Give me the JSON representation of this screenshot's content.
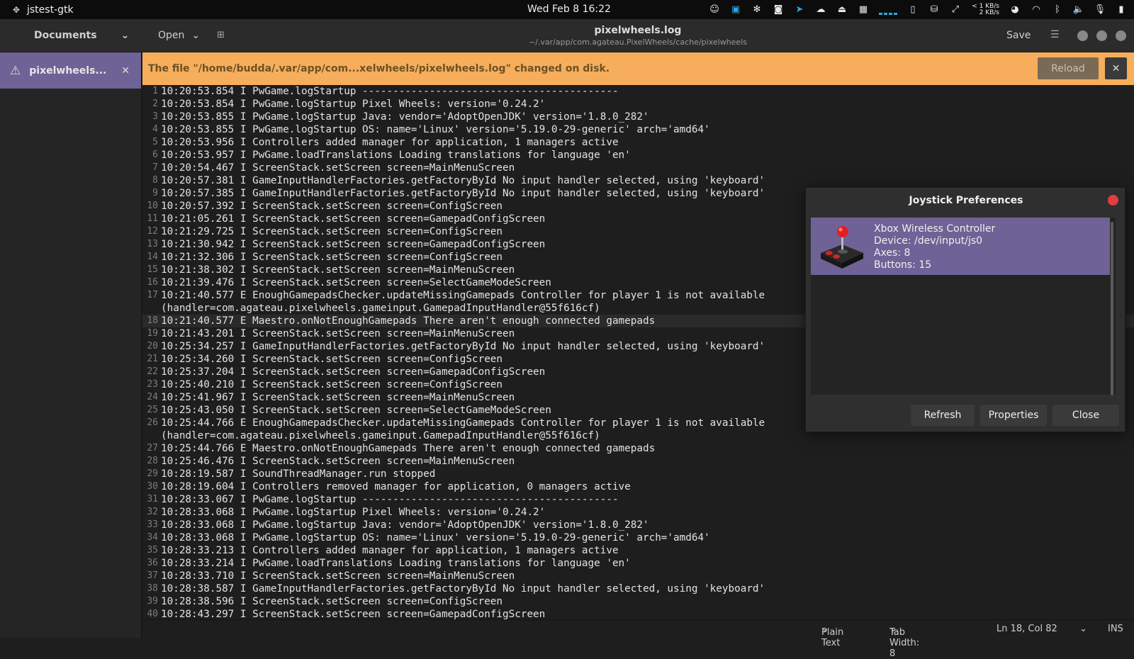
{
  "topbar": {
    "app_name": "jstest-gtk",
    "clock": "Wed Feb 8  16:22",
    "net_up": "< 1 KB/s",
    "net_down": "2 KB/s"
  },
  "header": {
    "documents_label": "Documents",
    "open_label": "Open",
    "title": "pixelwheels.log",
    "subtitle": "~/.var/app/com.agateau.PixelWheels/cache/pixelwheels",
    "save_label": "Save"
  },
  "sidebar": {
    "doc_name": "pixelwheels...."
  },
  "infobar": {
    "message": "The file \"/home/budda/.var/app/com...xelwheels/pixelwheels.log\" changed on disk.",
    "reload_label": "Reload"
  },
  "editor": {
    "lines": [
      {
        "n": "1",
        "t": "10:20:53.854 I PwGame.logStartup ------------------------------------------"
      },
      {
        "n": "2",
        "t": "10:20:53.854 I PwGame.logStartup Pixel Wheels: version='0.24.2'"
      },
      {
        "n": "3",
        "t": "10:20:53.855 I PwGame.logStartup Java: vendor='AdoptOpenJDK' version='1.8.0_282'"
      },
      {
        "n": "4",
        "t": "10:20:53.855 I PwGame.logStartup OS: name='Linux' version='5.19.0-29-generic' arch='amd64'"
      },
      {
        "n": "5",
        "t": "10:20:53.956 I Controllers added manager for application, 1 managers active"
      },
      {
        "n": "6",
        "t": "10:20:53.957 I PwGame.loadTranslations Loading translations for language 'en'"
      },
      {
        "n": "7",
        "t": "10:20:54.467 I ScreenStack.setScreen screen=MainMenuScreen"
      },
      {
        "n": "8",
        "t": "10:20:57.381 I GameInputHandlerFactories.getFactoryById No input handler selected, using 'keyboard'"
      },
      {
        "n": "9",
        "t": "10:20:57.385 I GameInputHandlerFactories.getFactoryById No input handler selected, using 'keyboard'"
      },
      {
        "n": "10",
        "t": "10:20:57.392 I ScreenStack.setScreen screen=ConfigScreen"
      },
      {
        "n": "11",
        "t": "10:21:05.261 I ScreenStack.setScreen screen=GamepadConfigScreen"
      },
      {
        "n": "12",
        "t": "10:21:29.725 I ScreenStack.setScreen screen=ConfigScreen"
      },
      {
        "n": "13",
        "t": "10:21:30.942 I ScreenStack.setScreen screen=GamepadConfigScreen"
      },
      {
        "n": "14",
        "t": "10:21:32.306 I ScreenStack.setScreen screen=ConfigScreen"
      },
      {
        "n": "15",
        "t": "10:21:38.302 I ScreenStack.setScreen screen=MainMenuScreen"
      },
      {
        "n": "16",
        "t": "10:21:39.476 I ScreenStack.setScreen screen=SelectGameModeScreen"
      },
      {
        "n": "17",
        "t": "10:21:40.577 E EnoughGamepadsChecker.updateMissingGamepads Controller for player 1 is not available"
      },
      {
        "n": "",
        "t": "(handler=com.agateau.pixelwheels.gameinput.GamepadInputHandler@55f616cf)"
      },
      {
        "n": "18",
        "t": "10:21:40.577 E Maestro.onNotEnoughGamepads There aren't enough connected gamepads"
      },
      {
        "n": "19",
        "t": "10:21:43.201 I ScreenStack.setScreen screen=MainMenuScreen"
      },
      {
        "n": "20",
        "t": "10:25:34.257 I GameInputHandlerFactories.getFactoryById No input handler selected, using 'keyboard'"
      },
      {
        "n": "21",
        "t": "10:25:34.260 I ScreenStack.setScreen screen=ConfigScreen"
      },
      {
        "n": "22",
        "t": "10:25:37.204 I ScreenStack.setScreen screen=GamepadConfigScreen"
      },
      {
        "n": "23",
        "t": "10:25:40.210 I ScreenStack.setScreen screen=ConfigScreen"
      },
      {
        "n": "24",
        "t": "10:25:41.967 I ScreenStack.setScreen screen=MainMenuScreen"
      },
      {
        "n": "25",
        "t": "10:25:43.050 I ScreenStack.setScreen screen=SelectGameModeScreen"
      },
      {
        "n": "26",
        "t": "10:25:44.766 E EnoughGamepadsChecker.updateMissingGamepads Controller for player 1 is not available"
      },
      {
        "n": "",
        "t": "(handler=com.agateau.pixelwheels.gameinput.GamepadInputHandler@55f616cf)"
      },
      {
        "n": "27",
        "t": "10:25:44.766 E Maestro.onNotEnoughGamepads There aren't enough connected gamepads"
      },
      {
        "n": "28",
        "t": "10:25:46.476 I ScreenStack.setScreen screen=MainMenuScreen"
      },
      {
        "n": "29",
        "t": "10:28:19.587 I SoundThreadManager.run stopped"
      },
      {
        "n": "30",
        "t": "10:28:19.604 I Controllers removed manager for application, 0 managers active"
      },
      {
        "n": "31",
        "t": "10:28:33.067 I PwGame.logStartup ------------------------------------------"
      },
      {
        "n": "32",
        "t": "10:28:33.068 I PwGame.logStartup Pixel Wheels: version='0.24.2'"
      },
      {
        "n": "33",
        "t": "10:28:33.068 I PwGame.logStartup Java: vendor='AdoptOpenJDK' version='1.8.0_282'"
      },
      {
        "n": "34",
        "t": "10:28:33.068 I PwGame.logStartup OS: name='Linux' version='5.19.0-29-generic' arch='amd64'"
      },
      {
        "n": "35",
        "t": "10:28:33.213 I Controllers added manager for application, 1 managers active"
      },
      {
        "n": "36",
        "t": "10:28:33.214 I PwGame.loadTranslations Loading translations for language 'en'"
      },
      {
        "n": "37",
        "t": "10:28:33.710 I ScreenStack.setScreen screen=MainMenuScreen"
      },
      {
        "n": "38",
        "t": "10:28:38.587 I GameInputHandlerFactories.getFactoryById No input handler selected, using 'keyboard'"
      },
      {
        "n": "39",
        "t": "10:28:38.596 I ScreenStack.setScreen screen=ConfigScreen"
      },
      {
        "n": "40",
        "t": "10:28:43.297 I ScreenStack.setScreen screen=GamepadConfigScreen"
      }
    ],
    "current_line_index": 18
  },
  "statusbar": {
    "language": "Plain Text",
    "tab_width": "Tab Width: 8",
    "position": "Ln 18, Col 82",
    "mode": "INS"
  },
  "dialog": {
    "title": "Joystick Preferences",
    "device_name": "Xbox Wireless Controller",
    "device_path": "Device: /dev/input/js0",
    "axes": "Axes: 8",
    "buttons": "Buttons: 15",
    "refresh_label": "Refresh",
    "properties_label": "Properties",
    "close_label": "Close"
  },
  "colors": {
    "accent": "#6f6296",
    "infobar": "#f6ae5c",
    "close_dot": "#e43d3d",
    "tray_blue": "#2aa7e0"
  }
}
